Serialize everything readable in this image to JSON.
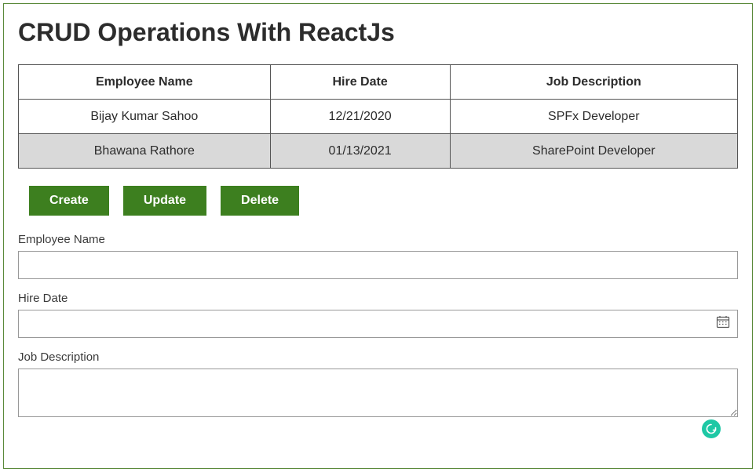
{
  "title": "CRUD Operations With ReactJs",
  "table": {
    "columns": [
      "Employee Name",
      "Hire Date",
      "Job Description"
    ],
    "rows": [
      {
        "name": "Bijay Kumar Sahoo",
        "hire_date": "12/21/2020",
        "job": "SPFx Developer",
        "selected": false
      },
      {
        "name": "Bhawana Rathore",
        "hire_date": "01/13/2021",
        "job": "SharePoint Developer",
        "selected": true
      }
    ]
  },
  "buttons": {
    "create": "Create",
    "update": "Update",
    "delete": "Delete"
  },
  "form": {
    "employee_name": {
      "label": "Employee Name",
      "value": ""
    },
    "hire_date": {
      "label": "Hire Date",
      "value": ""
    },
    "job_description": {
      "label": "Job Description",
      "value": ""
    }
  },
  "icons": {
    "calendar": "calendar-icon",
    "grammarly": "grammarly-icon"
  },
  "colors": {
    "frame_border": "#5a8a3a",
    "button_bg": "#3d7f1f",
    "selected_row": "#d9d9d9"
  }
}
